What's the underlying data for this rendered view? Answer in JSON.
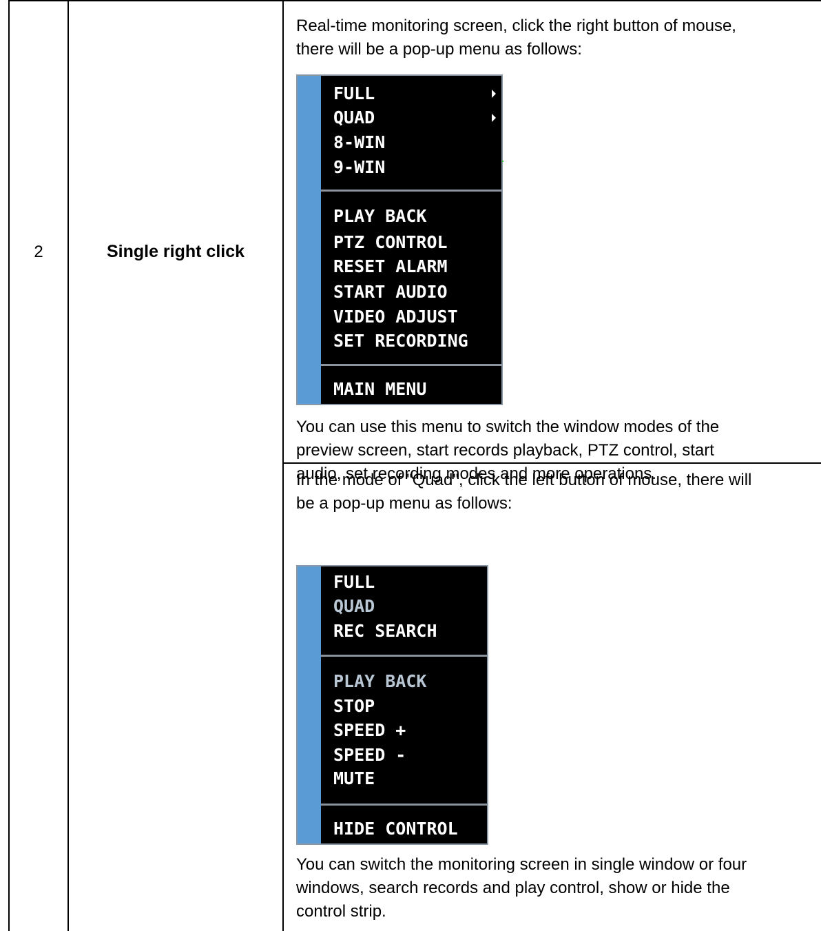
{
  "row": {
    "number": "2",
    "title": "Single right click"
  },
  "section1": {
    "intro_lines": [
      "Real-time monitoring screen, click the right button of mouse,",
      "there will be a pop-up menu as follows:"
    ],
    "menu": {
      "group1": [
        "FULL",
        "QUAD",
        "8-WIN",
        "9-WIN"
      ],
      "group2": [
        "PLAY BACK",
        "PTZ CONTROL",
        "RESET ALARM",
        "START AUDIO",
        "VIDEO ADJUST",
        "SET RECORDING"
      ],
      "group3": [
        "MAIN MENU"
      ]
    },
    "outro_lines": [
      "You can use this menu to switch the window modes of the",
      "preview screen, start records playback, PTZ control, start",
      "audio, set recording modes and more operations."
    ]
  },
  "section2": {
    "intro_lines": [
      "In the mode of \"Quad\", click the left button of mouse, there will",
      "be a pop-up menu as follows:"
    ],
    "menu": {
      "group1": [
        "FULL",
        "QUAD",
        "REC SEARCH"
      ],
      "group2": [
        "PLAY BACK",
        "STOP",
        "SPEED +",
        "SPEED -",
        "MUTE"
      ],
      "group3": [
        "HIDE CONTROL"
      ]
    },
    "outro_lines": [
      "You can switch the monitoring screen in single window or four",
      "windows, search records and play control, show or hide the",
      "control strip."
    ]
  },
  "colors": {
    "menu_strip": "#5b9bd5",
    "menu_bg": "#000000",
    "menu_text": "#ffffff",
    "menu_text_dim": "#b9c6d4"
  }
}
